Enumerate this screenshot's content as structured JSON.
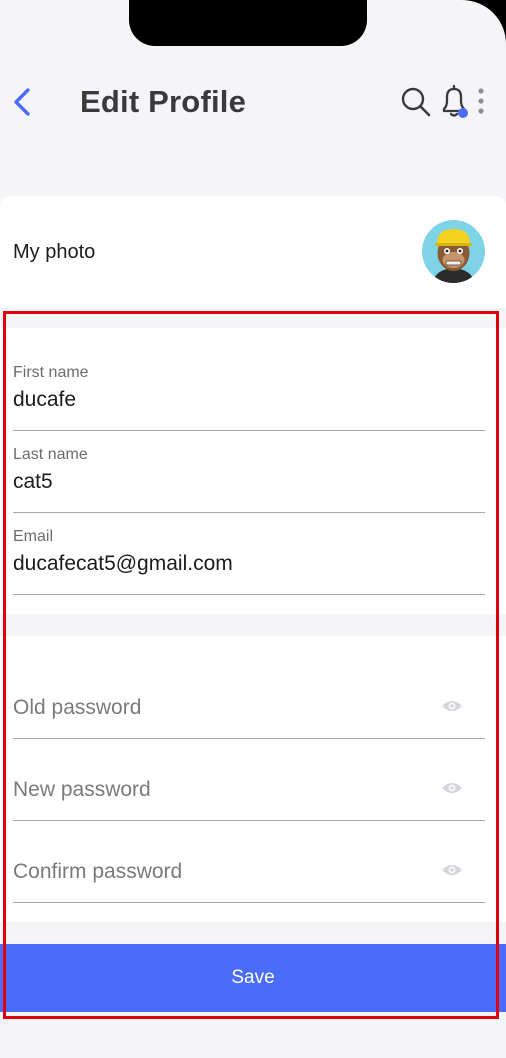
{
  "header": {
    "title": "Edit Profile",
    "back_icon": "chevron-left-icon",
    "search_icon": "search-icon",
    "bell_icon": "bell-icon",
    "more_icon": "more-vertical-icon"
  },
  "photo": {
    "label": "My photo",
    "avatar": "ape-avatar"
  },
  "profile": {
    "first_name": {
      "label": "First name",
      "value": "ducafe"
    },
    "last_name": {
      "label": "Last name",
      "value": "cat5"
    },
    "email": {
      "label": "Email",
      "value": "ducafecat5@gmail.com"
    }
  },
  "passwords": {
    "old": {
      "placeholder": "Old password"
    },
    "new": {
      "placeholder": "New password"
    },
    "confirm": {
      "placeholder": "Confirm password"
    },
    "toggle_icon": "eye-icon"
  },
  "save_label": "Save",
  "colors": {
    "accent": "#4a6cfb",
    "highlight": "#e0000e",
    "background": "#f5f5f7"
  }
}
